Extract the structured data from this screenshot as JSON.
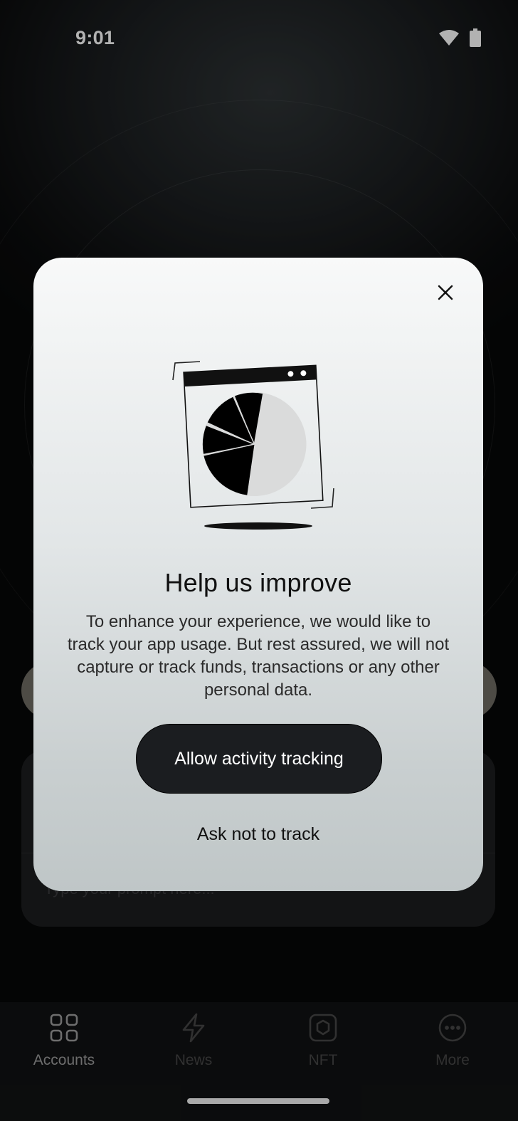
{
  "status_bar": {
    "time": "9:01",
    "icons": [
      "wifi-icon",
      "battery-icon"
    ]
  },
  "background": {
    "prompt_placeholder": "Type your prompt here..."
  },
  "modal": {
    "close_icon": "close-icon",
    "illustration": "analytics-pie-chart-illustration",
    "title": "Help us improve",
    "body": "To enhance your experience, we would like to track your app usage. But rest assured, we will not capture or track funds, transactions or any other personal data.",
    "allow_label": "Allow activity tracking",
    "deny_label": "Ask not to track"
  },
  "bottom_nav": {
    "items": [
      {
        "label": "Accounts",
        "icon": "grid-icon",
        "active": true
      },
      {
        "label": "News",
        "icon": "lightning-icon",
        "active": false
      },
      {
        "label": "NFT",
        "icon": "hexagon-icon",
        "active": false
      },
      {
        "label": "More",
        "icon": "more-dots-icon",
        "active": false
      }
    ]
  },
  "colors": {
    "modal_top": "#f8f9f9",
    "modal_bottom": "#bfc6c7",
    "primary_button": "#1b1d20",
    "nav_active": "#9c9c9c",
    "nav_inactive": "#474747"
  }
}
